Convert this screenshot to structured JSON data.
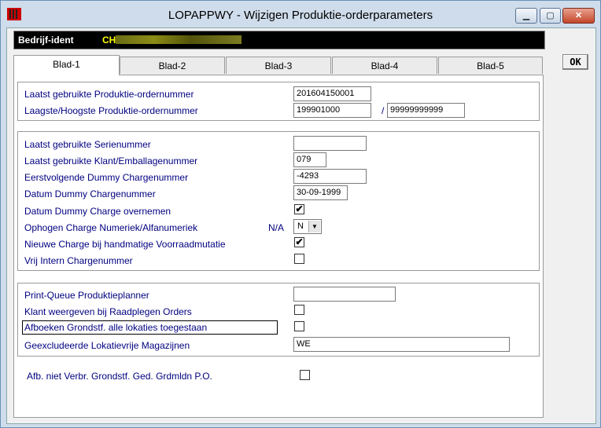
{
  "window": {
    "title": "LOPAPPWY - Wijzigen Produktie-orderparameters",
    "minimize_label": "▁",
    "maximize_label": "▢",
    "close_label": "✕"
  },
  "company": {
    "label": "Bedrijf-ident",
    "value_prefix": "CH"
  },
  "ok_button": "OK",
  "tabs": [
    "Blad-1",
    "Blad-2",
    "Blad-3",
    "Blad-4",
    "Blad-5"
  ],
  "group1": {
    "last_order_label": "Laatst gebruikte Produktie-ordernummer",
    "last_order_value": "201604150001",
    "range_label": "Laagste/Hoogste  Produktie-ordernummer",
    "range_low": "199901000",
    "range_sep": "/",
    "range_high": "99999999999"
  },
  "group2": {
    "serial_label": "Laatst gebruikte Serienummer",
    "serial_value": "",
    "customer_pack_label": "Laatst gebruikte Klant/Emballagenummer",
    "customer_pack_value": "079",
    "dummy_charge_label": "Eerstvolgende Dummy Chargenummer",
    "dummy_charge_value": "-4293",
    "dummy_date_label": "Datum Dummy Chargenummer",
    "dummy_date_value": "30-09-1999",
    "dummy_take_label": "Datum Dummy Charge overnemen",
    "increment_label": "Ophogen Charge Numeriek/Alfanumeriek",
    "increment_na": "N/A",
    "increment_value": "N",
    "new_charge_label": "Nieuwe Charge bij handmatige Voorraadmutatie",
    "free_charge_label": "Vrij Intern Chargenummer"
  },
  "group3": {
    "print_queue_label": "Print-Queue Produktieplanner",
    "print_queue_value": "",
    "show_customer_label": "Klant weergeven bij Raadplegen Orders",
    "book_raw_label": "Afboeken Grondstf. alle lokaties toegestaan",
    "excluded_label": "Geexcludeerde Lokatievrije Magazijnen",
    "excluded_value": "WE"
  },
  "bottom": {
    "unused_raw_label": "Afb. niet Verbr. Grondstf. Ged. Grdmldn P.O."
  },
  "checkmark": "✔",
  "dropdown_arrow": "▼"
}
